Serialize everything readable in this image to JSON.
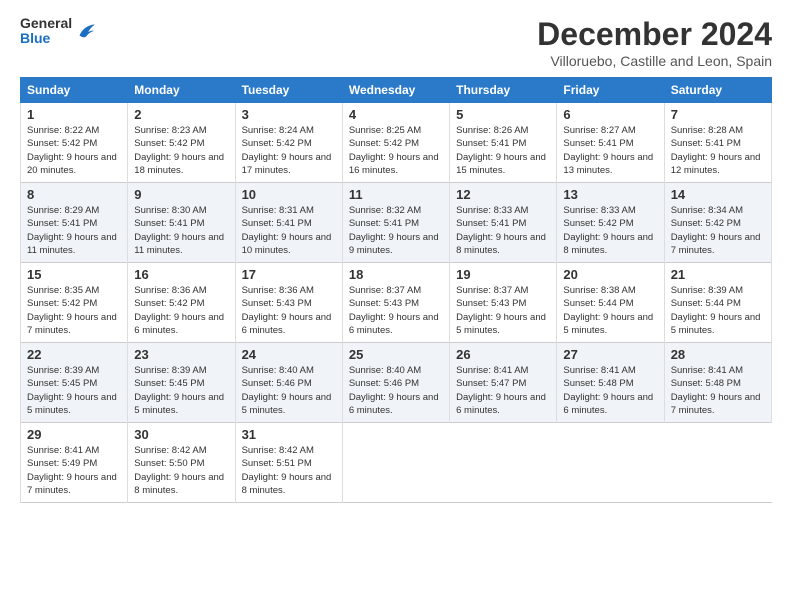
{
  "header": {
    "title": "December 2024",
    "location": "Villoruebo, Castille and Leon, Spain"
  },
  "logo": {
    "line1": "General",
    "line2": "Blue"
  },
  "days_of_week": [
    "Sunday",
    "Monday",
    "Tuesday",
    "Wednesday",
    "Thursday",
    "Friday",
    "Saturday"
  ],
  "weeks": [
    [
      {
        "day": "1",
        "sunrise": "8:22 AM",
        "sunset": "5:42 PM",
        "daylight": "9 hours and 20 minutes."
      },
      {
        "day": "2",
        "sunrise": "8:23 AM",
        "sunset": "5:42 PM",
        "daylight": "9 hours and 18 minutes."
      },
      {
        "day": "3",
        "sunrise": "8:24 AM",
        "sunset": "5:42 PM",
        "daylight": "9 hours and 17 minutes."
      },
      {
        "day": "4",
        "sunrise": "8:25 AM",
        "sunset": "5:42 PM",
        "daylight": "9 hours and 16 minutes."
      },
      {
        "day": "5",
        "sunrise": "8:26 AM",
        "sunset": "5:41 PM",
        "daylight": "9 hours and 15 minutes."
      },
      {
        "day": "6",
        "sunrise": "8:27 AM",
        "sunset": "5:41 PM",
        "daylight": "9 hours and 13 minutes."
      },
      {
        "day": "7",
        "sunrise": "8:28 AM",
        "sunset": "5:41 PM",
        "daylight": "9 hours and 12 minutes."
      }
    ],
    [
      {
        "day": "8",
        "sunrise": "8:29 AM",
        "sunset": "5:41 PM",
        "daylight": "9 hours and 11 minutes."
      },
      {
        "day": "9",
        "sunrise": "8:30 AM",
        "sunset": "5:41 PM",
        "daylight": "9 hours and 11 minutes."
      },
      {
        "day": "10",
        "sunrise": "8:31 AM",
        "sunset": "5:41 PM",
        "daylight": "9 hours and 10 minutes."
      },
      {
        "day": "11",
        "sunrise": "8:32 AM",
        "sunset": "5:41 PM",
        "daylight": "9 hours and 9 minutes."
      },
      {
        "day": "12",
        "sunrise": "8:33 AM",
        "sunset": "5:41 PM",
        "daylight": "9 hours and 8 minutes."
      },
      {
        "day": "13",
        "sunrise": "8:33 AM",
        "sunset": "5:42 PM",
        "daylight": "9 hours and 8 minutes."
      },
      {
        "day": "14",
        "sunrise": "8:34 AM",
        "sunset": "5:42 PM",
        "daylight": "9 hours and 7 minutes."
      }
    ],
    [
      {
        "day": "15",
        "sunrise": "8:35 AM",
        "sunset": "5:42 PM",
        "daylight": "9 hours and 7 minutes."
      },
      {
        "day": "16",
        "sunrise": "8:36 AM",
        "sunset": "5:42 PM",
        "daylight": "9 hours and 6 minutes."
      },
      {
        "day": "17",
        "sunrise": "8:36 AM",
        "sunset": "5:43 PM",
        "daylight": "9 hours and 6 minutes."
      },
      {
        "day": "18",
        "sunrise": "8:37 AM",
        "sunset": "5:43 PM",
        "daylight": "9 hours and 6 minutes."
      },
      {
        "day": "19",
        "sunrise": "8:37 AM",
        "sunset": "5:43 PM",
        "daylight": "9 hours and 5 minutes."
      },
      {
        "day": "20",
        "sunrise": "8:38 AM",
        "sunset": "5:44 PM",
        "daylight": "9 hours and 5 minutes."
      },
      {
        "day": "21",
        "sunrise": "8:39 AM",
        "sunset": "5:44 PM",
        "daylight": "9 hours and 5 minutes."
      }
    ],
    [
      {
        "day": "22",
        "sunrise": "8:39 AM",
        "sunset": "5:45 PM",
        "daylight": "9 hours and 5 minutes."
      },
      {
        "day": "23",
        "sunrise": "8:39 AM",
        "sunset": "5:45 PM",
        "daylight": "9 hours and 5 minutes."
      },
      {
        "day": "24",
        "sunrise": "8:40 AM",
        "sunset": "5:46 PM",
        "daylight": "9 hours and 5 minutes."
      },
      {
        "day": "25",
        "sunrise": "8:40 AM",
        "sunset": "5:46 PM",
        "daylight": "9 hours and 6 minutes."
      },
      {
        "day": "26",
        "sunrise": "8:41 AM",
        "sunset": "5:47 PM",
        "daylight": "9 hours and 6 minutes."
      },
      {
        "day": "27",
        "sunrise": "8:41 AM",
        "sunset": "5:48 PM",
        "daylight": "9 hours and 6 minutes."
      },
      {
        "day": "28",
        "sunrise": "8:41 AM",
        "sunset": "5:48 PM",
        "daylight": "9 hours and 7 minutes."
      }
    ],
    [
      {
        "day": "29",
        "sunrise": "8:41 AM",
        "sunset": "5:49 PM",
        "daylight": "9 hours and 7 minutes."
      },
      {
        "day": "30",
        "sunrise": "8:42 AM",
        "sunset": "5:50 PM",
        "daylight": "9 hours and 8 minutes."
      },
      {
        "day": "31",
        "sunrise": "8:42 AM",
        "sunset": "5:51 PM",
        "daylight": "9 hours and 8 minutes."
      },
      null,
      null,
      null,
      null
    ]
  ],
  "labels": {
    "sunrise": "Sunrise:",
    "sunset": "Sunset:",
    "daylight": "Daylight:"
  }
}
